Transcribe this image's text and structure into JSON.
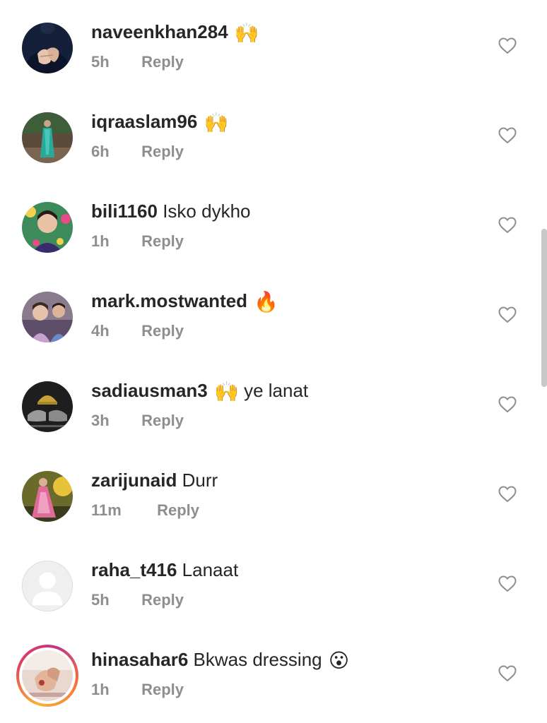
{
  "comments": [
    {
      "username": "naveenkhan284",
      "text": "",
      "emoji": "🙌",
      "time": "5h",
      "reply_label": "Reply",
      "avatar": "avatar-hands-dark"
    },
    {
      "username": "iqraaslam96",
      "text": "",
      "emoji": "🙌",
      "time": "6h",
      "reply_label": "Reply",
      "avatar": "avatar-woman-green-dress"
    },
    {
      "username": "bili1160",
      "text": "Isko dykho",
      "emoji": "",
      "time": "1h",
      "reply_label": "Reply",
      "avatar": "avatar-girl-portrait"
    },
    {
      "username": "mark.mostwanted",
      "text": "",
      "emoji": "🔥",
      "time": "4h",
      "reply_label": "Reply",
      "avatar": "avatar-two-kids"
    },
    {
      "username": "sadiausman3",
      "text": "ye lanat",
      "emoji": "🙌",
      "emoji_before_text": true,
      "time": "3h",
      "reply_label": "Reply",
      "avatar": "avatar-hands-dome"
    },
    {
      "username": "zarijunaid",
      "text": "Durr",
      "emoji": "",
      "time": "11m",
      "reply_label": "Reply",
      "avatar": "avatar-girl-pink-dress"
    },
    {
      "username": "raha_t416",
      "text": "Lanaat",
      "emoji": "",
      "time": "5h",
      "reply_label": "Reply",
      "avatar": "avatar-default-silhouette"
    },
    {
      "username": "hinasahar6",
      "text": "Bkwas dressing",
      "emoji": "😮",
      "time": "1h",
      "reply_label": "Reply",
      "avatar": "avatar-story-ring-hands",
      "has_story": true
    }
  ],
  "icons": {
    "like": "heart-outline-icon"
  },
  "colors": {
    "text_primary": "#262626",
    "text_secondary": "#8e8e8e",
    "story_ring": "#e4405f",
    "background": "#ffffff"
  }
}
